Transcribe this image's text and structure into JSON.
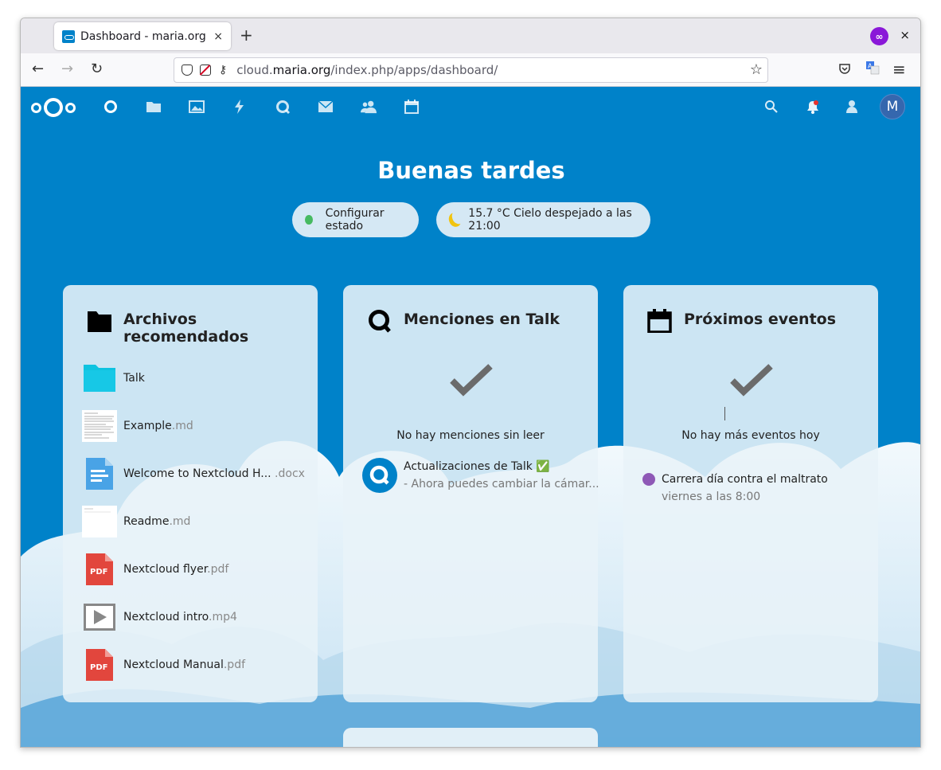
{
  "browser": {
    "tab_title": "Dashboard - maria.org",
    "tab_close": "×",
    "new_tab": "+",
    "window_close": "×",
    "url_prefix": "cloud.",
    "url_domain": "maria.org",
    "url_path": "/index.php/apps/dashboard/",
    "back": "←",
    "forward": "→",
    "reload": "↻",
    "bookmark_star": "☆",
    "menu": "≡"
  },
  "header": {
    "apps": [
      "dashboard-icon",
      "files-icon",
      "photos-icon",
      "activity-icon",
      "talk-icon",
      "mail-icon",
      "contacts-icon",
      "calendar-icon"
    ],
    "avatar_initial": "M"
  },
  "greeting": "Buenas tardes",
  "status": {
    "label": "Configurar estado",
    "weather": "15.7 °C Cielo despejado a las 21:00"
  },
  "panels": {
    "files": {
      "title": "Archivos recomendados",
      "items": [
        {
          "name": "Talk",
          "ext": "",
          "icon": "folder-icon"
        },
        {
          "name": "Example",
          "ext": ".md",
          "icon": "document-thumbnail-icon"
        },
        {
          "name": "Welcome to Nextcloud H...",
          "ext": " .docx",
          "icon": "text-document-icon"
        },
        {
          "name": "Readme",
          "ext": ".md",
          "icon": "blank-document-icon"
        },
        {
          "name": "Nextcloud flyer",
          "ext": ".pdf",
          "icon": "pdf-icon"
        },
        {
          "name": "Nextcloud intro",
          "ext": ".mp4",
          "icon": "video-icon"
        },
        {
          "name": "Nextcloud Manual",
          "ext": ".pdf",
          "icon": "pdf-icon"
        }
      ]
    },
    "talk": {
      "title": "Menciones en Talk",
      "empty": "No hay menciones sin leer",
      "item_title": "Actualizaciones de Talk ✅",
      "item_sub": "- Ahora puedes cambiar la cámar..."
    },
    "events": {
      "title": "Próximos eventos",
      "empty": "No hay más eventos hoy",
      "item_title": "Carrera día contra el maltrato",
      "item_sub": "viernes a las 8:00"
    }
  },
  "pdf_label": "PDF",
  "colors": {
    "brand": "#0082c9",
    "status_online": "#46ba61",
    "event_dot": "#8e58b6",
    "folder": "#0ec3e0",
    "pdf": "#e2463d"
  }
}
